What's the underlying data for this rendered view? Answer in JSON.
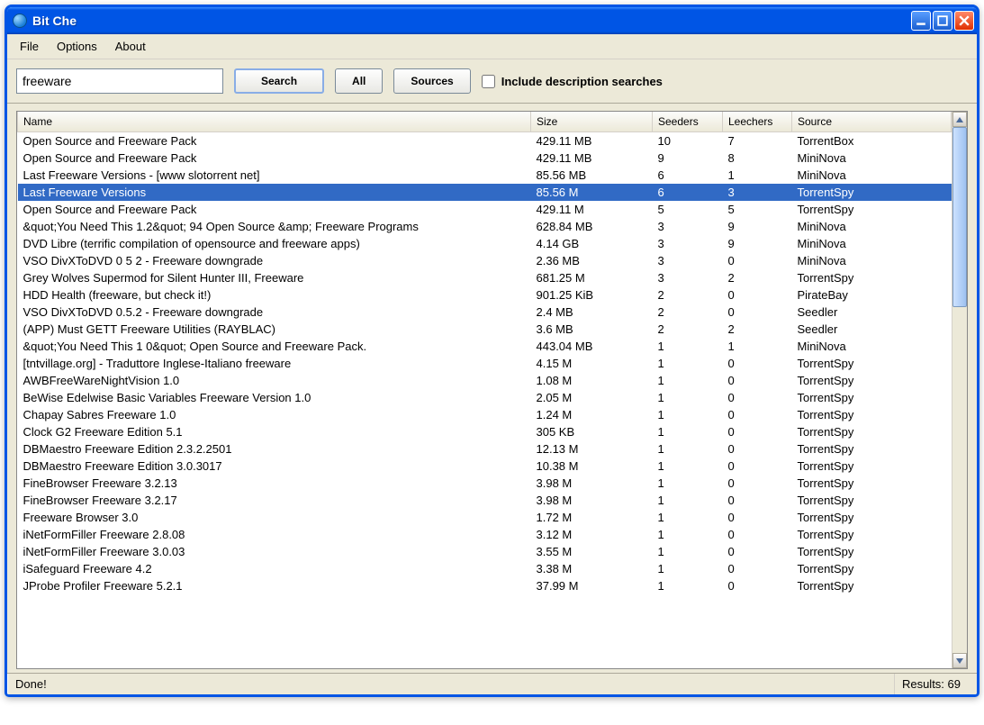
{
  "window": {
    "title": "Bit Che"
  },
  "menu": {
    "items": [
      "File",
      "Options",
      "About"
    ]
  },
  "toolbar": {
    "search_value": "freeware",
    "search_btn": "Search",
    "all_btn": "All",
    "sources_btn": "Sources",
    "include_desc_label": "Include description searches",
    "include_desc_checked": false
  },
  "columns": [
    "Name",
    "Size",
    "Seeders",
    "Leechers",
    "Source"
  ],
  "selected_index": 3,
  "rows": [
    {
      "name": "Open Source and Freeware Pack",
      "size": "429.11 MB",
      "seeders": "10",
      "leechers": "7",
      "source": "TorrentBox"
    },
    {
      "name": "Open Source and Freeware Pack",
      "size": "429.11 MB",
      "seeders": "9",
      "leechers": "8",
      "source": "MiniNova"
    },
    {
      "name": "Last Freeware Versions - [www slotorrent net]",
      "size": "85.56 MB",
      "seeders": "6",
      "leechers": "1",
      "source": "MiniNova"
    },
    {
      "name": "Last Freeware Versions",
      "size": "85.56 M",
      "seeders": "6",
      "leechers": "3",
      "source": "TorrentSpy"
    },
    {
      "name": "Open Source and Freeware Pack",
      "size": "429.11 M",
      "seeders": "5",
      "leechers": "5",
      "source": "TorrentSpy"
    },
    {
      "name": "&quot;You Need This 1.2&quot; 94 Open Source &amp; Freeware Programs",
      "size": "628.84 MB",
      "seeders": "3",
      "leechers": "9",
      "source": "MiniNova"
    },
    {
      "name": "DVD Libre (terrific compilation of opensource and freeware apps)",
      "size": "4.14 GB",
      "seeders": "3",
      "leechers": "9",
      "source": "MiniNova"
    },
    {
      "name": "VSO DivXToDVD 0 5 2 - Freeware downgrade",
      "size": "2.36 MB",
      "seeders": "3",
      "leechers": "0",
      "source": "MiniNova"
    },
    {
      "name": "Grey Wolves Supermod for Silent Hunter III, Freeware",
      "size": "681.25 M",
      "seeders": "3",
      "leechers": "2",
      "source": "TorrentSpy"
    },
    {
      "name": "HDD Health (freeware, but check it!)",
      "size": "901.25 KiB",
      "seeders": "2",
      "leechers": "0",
      "source": "PirateBay"
    },
    {
      "name": "VSO DivXToDVD 0.5.2 - Freeware downgrade",
      "size": "2.4 MB",
      "seeders": "2",
      "leechers": "0",
      "source": "Seedler"
    },
    {
      "name": "(APP) Must GETT Freeware Utilities (RAYBLAC)",
      "size": "3.6 MB",
      "seeders": "2",
      "leechers": "2",
      "source": "Seedler"
    },
    {
      "name": "&quot;You Need This 1 0&quot; Open Source and Freeware Pack.",
      "size": "443.04 MB",
      "seeders": "1",
      "leechers": "1",
      "source": "MiniNova"
    },
    {
      "name": "[tntvillage.org] - Traduttore Inglese-Italiano freeware",
      "size": "4.15 M",
      "seeders": "1",
      "leechers": "0",
      "source": "TorrentSpy"
    },
    {
      "name": "AWBFreeWareNightVision 1.0",
      "size": "1.08 M",
      "seeders": "1",
      "leechers": "0",
      "source": "TorrentSpy"
    },
    {
      "name": "BeWise Edelwise Basic Variables Freeware Version 1.0",
      "size": "2.05 M",
      "seeders": "1",
      "leechers": "0",
      "source": "TorrentSpy"
    },
    {
      "name": "Chapay Sabres Freeware 1.0",
      "size": "1.24 M",
      "seeders": "1",
      "leechers": "0",
      "source": "TorrentSpy"
    },
    {
      "name": "Clock G2 Freeware Edition 5.1",
      "size": "305 KB",
      "seeders": "1",
      "leechers": "0",
      "source": "TorrentSpy"
    },
    {
      "name": "DBMaestro Freeware Edition 2.3.2.2501",
      "size": "12.13 M",
      "seeders": "1",
      "leechers": "0",
      "source": "TorrentSpy"
    },
    {
      "name": "DBMaestro Freeware Edition 3.0.3017",
      "size": "10.38 M",
      "seeders": "1",
      "leechers": "0",
      "source": "TorrentSpy"
    },
    {
      "name": "FineBrowser Freeware 3.2.13",
      "size": "3.98 M",
      "seeders": "1",
      "leechers": "0",
      "source": "TorrentSpy"
    },
    {
      "name": "FineBrowser Freeware 3.2.17",
      "size": "3.98 M",
      "seeders": "1",
      "leechers": "0",
      "source": "TorrentSpy"
    },
    {
      "name": "Freeware Browser 3.0",
      "size": "1.72 M",
      "seeders": "1",
      "leechers": "0",
      "source": "TorrentSpy"
    },
    {
      "name": "iNetFormFiller Freeware 2.8.08",
      "size": "3.12 M",
      "seeders": "1",
      "leechers": "0",
      "source": "TorrentSpy"
    },
    {
      "name": "iNetFormFiller Freeware 3.0.03",
      "size": "3.55 M",
      "seeders": "1",
      "leechers": "0",
      "source": "TorrentSpy"
    },
    {
      "name": "iSafeguard Freeware 4.2",
      "size": "3.38 M",
      "seeders": "1",
      "leechers": "0",
      "source": "TorrentSpy"
    },
    {
      "name": "JProbe Profiler Freeware 5.2.1",
      "size": "37.99 M",
      "seeders": "1",
      "leechers": "0",
      "source": "TorrentSpy"
    }
  ],
  "status": {
    "left": "Done!",
    "right": "Results: 69"
  }
}
